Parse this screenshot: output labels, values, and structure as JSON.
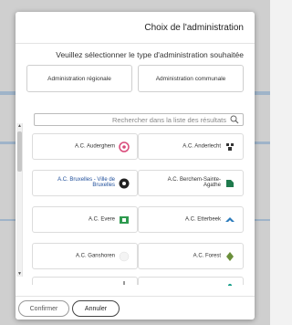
{
  "dialog": {
    "title": "Choix de l'administration",
    "subtitle": "Veuillez sélectionner le type d'administration souhaitée",
    "type_communal": "Administration communale",
    "type_regional": "Administration régionale"
  },
  "search": {
    "placeholder": "Rechercher dans la liste des résultats"
  },
  "administrations": [
    {
      "label": "A.C. Anderlecht",
      "logo": "anderlecht-logo"
    },
    {
      "label": "A.C. Auderghem",
      "logo": "auderghem-logo"
    },
    {
      "label": "A.C. Berchem-Sainte-Agathe",
      "logo": "berchem-logo"
    },
    {
      "label": "A.C. Bruxelles - Ville de Bruxelles",
      "logo": "bruxelles-logo"
    },
    {
      "label": "A.C. Etterbeek",
      "logo": "etterbeek-logo"
    },
    {
      "label": "A.C. Evere",
      "logo": "evere-logo"
    },
    {
      "label": "A.C. Forest",
      "logo": "forest-logo"
    },
    {
      "label": "A.C. Ganshoren",
      "logo": "ganshoren-logo"
    }
  ],
  "footer": {
    "cancel_label": "Annuler",
    "confirm_label": "Confirmer"
  }
}
